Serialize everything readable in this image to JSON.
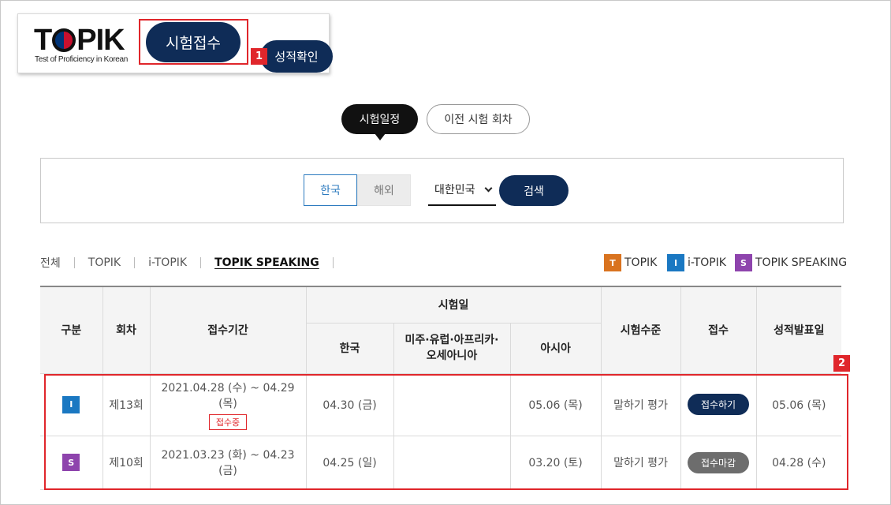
{
  "header": {
    "logo_text": "TOPIK",
    "logo_subtitle": "Test of Proficiency in Korean",
    "apply_label": "시험접수",
    "score_label": "성적확인"
  },
  "callouts": {
    "one": "1",
    "two": "2"
  },
  "tabs": {
    "schedule": "시험일정",
    "previous": "이전 시험 회차"
  },
  "search": {
    "korea": "한국",
    "abroad": "해외",
    "country": "대한민국",
    "button": "검색"
  },
  "filters": [
    "전체",
    "TOPIK",
    "i-TOPIK",
    "TOPIK SPEAKING"
  ],
  "legend": [
    {
      "letter": "T",
      "label": "TOPIK",
      "color": "#d9731f"
    },
    {
      "letter": "I",
      "label": "i-TOPIK",
      "color": "#1a78c2"
    },
    {
      "letter": "S",
      "label": "TOPIK SPEAKING",
      "color": "#8e44ad"
    }
  ],
  "table": {
    "headers": {
      "type": "구분",
      "round": "회차",
      "period": "접수기간",
      "exam_date": "시험일",
      "korea": "한국",
      "americas": "미주·유럽·아프리카·오세아니아",
      "asia": "아시아",
      "level": "시험수준",
      "register": "접수",
      "results": "성적발표일"
    },
    "rows": [
      {
        "type": "I",
        "type_color": "#1a78c2",
        "round": "제13회",
        "period": "2021.04.28 (수) ~ 04.29 (목)",
        "status": "접수중",
        "korea": "04.30 (금)",
        "americas": "",
        "asia": "05.06 (목)",
        "level": "말하기 평가",
        "register": "접수하기",
        "register_color": "#0f2c57",
        "results": "05.06 (목)"
      },
      {
        "type": "S",
        "type_color": "#8e44ad",
        "round": "제10회",
        "period": "2021.03.23 (화) ~ 04.23 (금)",
        "korea": "04.25 (일)",
        "americas": "",
        "asia": "03.20 (토)",
        "level": "말하기 평가",
        "register": "접수마감",
        "register_color": "#6d6d6d",
        "results": "04.28 (수)"
      }
    ]
  }
}
